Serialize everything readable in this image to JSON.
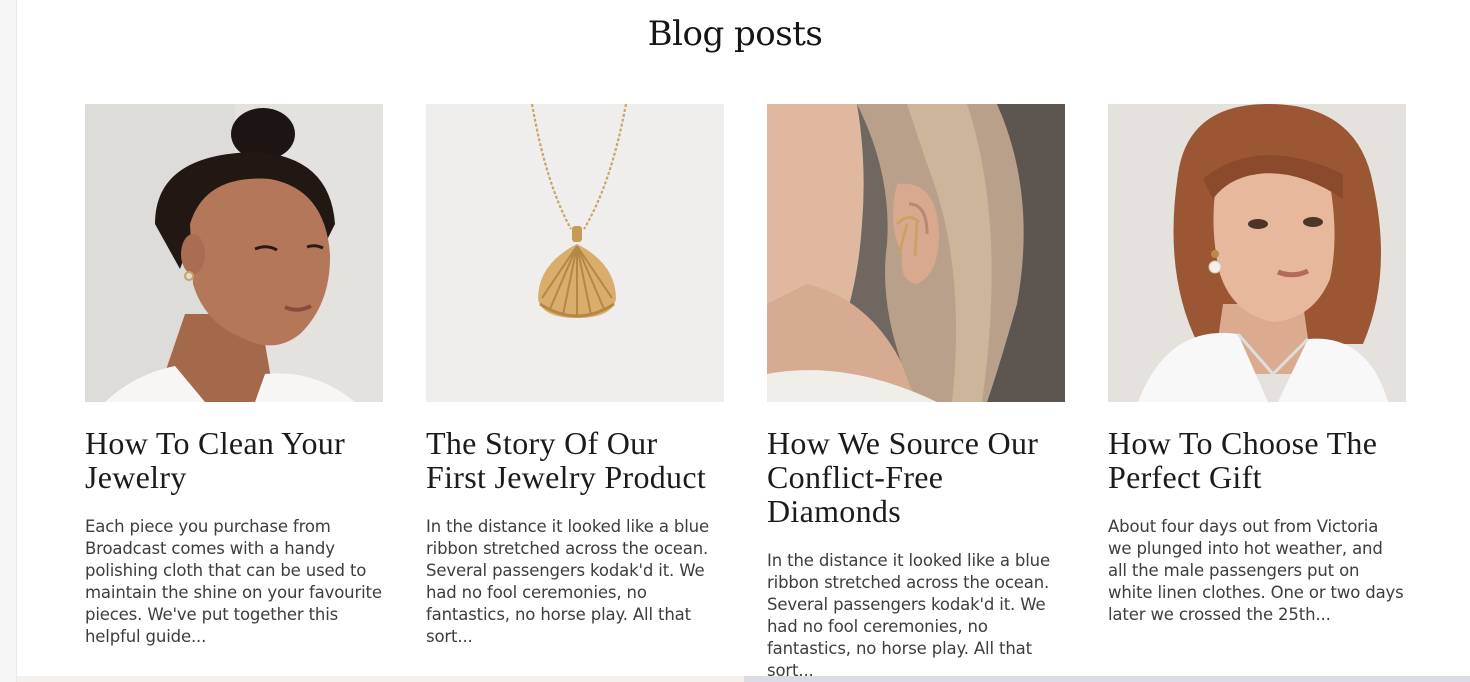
{
  "section": {
    "title": "Blog posts"
  },
  "posts": [
    {
      "title": "How To Clean Your Jewelry",
      "excerpt": "Each piece you purchase from Broadcast comes with a handy polishing cloth that can be used to maintain the shine on your favourite pieces. We've put together this helpful guide...",
      "image_icon": "woman-with-earring-photo"
    },
    {
      "title": "The Story Of Our First Jewelry Product",
      "excerpt": "In the distance it looked like a blue ribbon stretched across the ocean. Several passengers kodak'd it. We had no fool ceremonies, no fantastics, no horse play. All that sort...",
      "image_icon": "shell-pendant-necklace-photo"
    },
    {
      "title": "How We Source Our Conflict-Free Diamonds",
      "excerpt": "In the distance it looked like a blue ribbon stretched across the ocean. Several passengers kodak'd it. We had no fool ceremonies, no fantastics, no horse play. All that sort...",
      "image_icon": "ear-cuff-closeup-photo"
    },
    {
      "title": "How To Choose The Perfect Gift",
      "excerpt": "About four days out from Victoria we plunged into hot weather, and all the male passengers put on white linen clothes. One or two days later we crossed the 25th...",
      "image_icon": "red-haired-woman-pearl-earring-photo"
    }
  ],
  "colors": {
    "background": "#ffffff",
    "heading": "#151515",
    "body_text": "#3d3d3d"
  }
}
